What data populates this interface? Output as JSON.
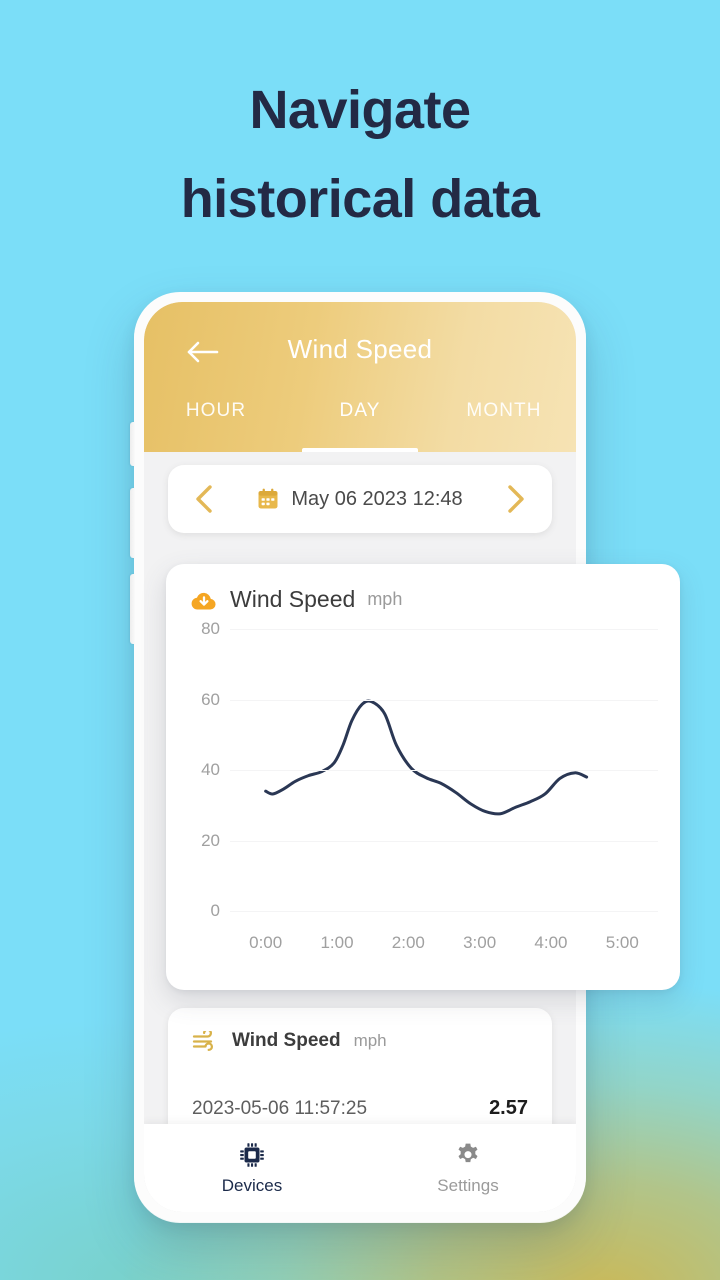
{
  "promo": {
    "headline_line1": "Navigate",
    "headline_line2": "historical data",
    "headline_color": "#232A45",
    "background_top_color": "#7BDEF8",
    "background_bottom_accent": "#CEB750"
  },
  "app": {
    "header": {
      "back_icon": "arrow-left-icon",
      "title": "Wind Speed",
      "gradient_from": "#E6C065",
      "gradient_to": "#F6E3B4",
      "tabs": [
        {
          "label": "HOUR",
          "active": false
        },
        {
          "label": "DAY",
          "active": true
        },
        {
          "label": "MONTH",
          "active": false
        }
      ]
    },
    "date_bar": {
      "prev_icon": "chevron-left-icon",
      "next_icon": "chevron-right-icon",
      "calendar_icon": "calendar-icon",
      "value": "May 06 2023 12:48",
      "accent_color": "#E3B857"
    },
    "chart_card": {
      "icon": "cloud-download-icon",
      "icon_color": "#F5A623",
      "title": "Wind Speed",
      "unit": "mph"
    },
    "list_card": {
      "icon": "wind-icon",
      "icon_color": "#D8B24A",
      "title": "Wind Speed",
      "unit": "mph",
      "rows": [
        {
          "timestamp": "2023-05-06 11:57:25",
          "value": "2.57"
        }
      ]
    },
    "bottom_nav": [
      {
        "label": "Devices",
        "icon": "chip-icon",
        "active": true,
        "color": "#1B2A4A"
      },
      {
        "label": "Settings",
        "icon": "gear-icon",
        "active": false,
        "color": "#9B9B9B"
      }
    ]
  },
  "chart_data": {
    "type": "line",
    "title": "Wind Speed",
    "xlabel": "",
    "ylabel": "mph",
    "unit": "mph",
    "line_color": "#2A3754",
    "grid": true,
    "legend": "none",
    "ylim": [
      0,
      80
    ],
    "yticks": [
      80,
      60,
      40,
      20,
      0
    ],
    "xticks": [
      "0:00",
      "1:00",
      "2:00",
      "3:00",
      "4:00",
      "5:00"
    ],
    "x": [
      0,
      0.12,
      0.3,
      0.5,
      0.72,
      0.95,
      1.15,
      1.3,
      1.45,
      1.62,
      1.78,
      2.0,
      2.2,
      2.45,
      2.7,
      2.95,
      3.2,
      3.45,
      3.7,
      3.95,
      4.2,
      4.45,
      4.7,
      4.95,
      5.2,
      5.4
    ],
    "values": [
      34.0,
      33.2,
      34.6,
      36.8,
      38.4,
      39.6,
      42.0,
      47.0,
      54.0,
      58.6,
      59.4,
      56.0,
      47.0,
      40.5,
      37.8,
      36.2,
      33.6,
      30.4,
      28.2,
      27.6,
      29.4,
      31.0,
      33.2,
      37.6,
      39.2,
      38.0
    ],
    "series": [
      {
        "name": "Wind Speed",
        "color": "#2A3754",
        "values": [
          34.0,
          33.2,
          34.6,
          36.8,
          38.4,
          39.6,
          42.0,
          47.0,
          54.0,
          58.6,
          59.4,
          56.0,
          47.0,
          40.5,
          37.8,
          36.2,
          33.6,
          30.4,
          28.2,
          27.6,
          29.4,
          31.0,
          33.2,
          37.6,
          39.2,
          38.0
        ]
      }
    ]
  }
}
